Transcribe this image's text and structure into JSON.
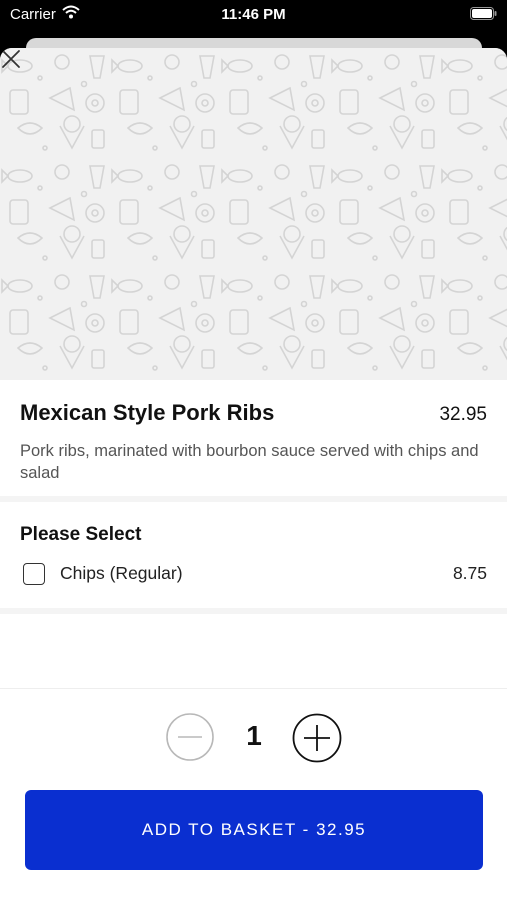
{
  "status_bar": {
    "carrier": "Carrier",
    "time": "11:46 PM"
  },
  "item": {
    "title": "Mexican Style Pork Ribs",
    "price": "32.95",
    "description": "Pork ribs, marinated with bourbon sauce served with chips and salad"
  },
  "options_section": {
    "title": "Please Select",
    "options": [
      {
        "label": "Chips (Regular)",
        "price": "8.75",
        "checked": false
      }
    ]
  },
  "quantity": {
    "value": "1"
  },
  "add_button": {
    "label": "ADD TO BASKET  -  32.95"
  },
  "colors": {
    "accent": "#0a2fd0",
    "hero_bg": "#f1f1f1",
    "divider": "#f4f4f4"
  },
  "icons": [
    "wifi-icon",
    "battery-icon",
    "close-icon",
    "minus-icon",
    "plus-icon"
  ]
}
